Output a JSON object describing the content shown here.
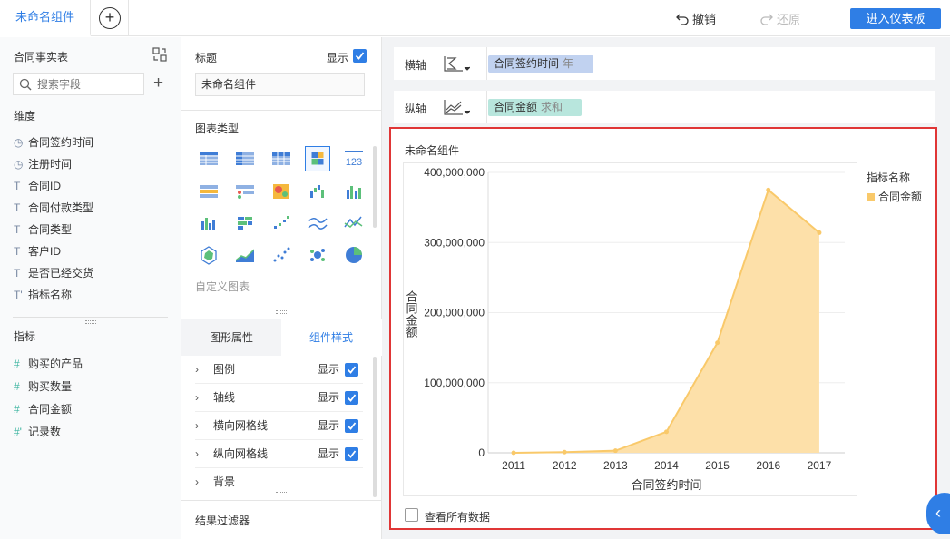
{
  "tabs": {
    "active_label": "未命名组件"
  },
  "toolbar": {
    "undo_label": "撤销",
    "redo_label": "还原",
    "enter_label": "进入仪表板"
  },
  "left_panel": {
    "table_name": "合同事实表",
    "search_placeholder": "搜索字段",
    "dimensions_title": "维度",
    "dimensions": [
      {
        "icon": "clock",
        "label": "合同签约时间"
      },
      {
        "icon": "clock",
        "label": "注册时间"
      },
      {
        "icon": "text",
        "label": "合同ID"
      },
      {
        "icon": "text",
        "label": "合同付款类型"
      },
      {
        "icon": "text",
        "label": "合同类型"
      },
      {
        "icon": "text",
        "label": "客户ID"
      },
      {
        "icon": "text",
        "label": "是否已经交货"
      },
      {
        "icon": "text-star",
        "label": "指标名称"
      }
    ],
    "measures_title": "指标",
    "measures": [
      {
        "icon": "hash",
        "label": "购买的产品"
      },
      {
        "icon": "hash",
        "label": "购买数量"
      },
      {
        "icon": "hash",
        "label": "合同金额"
      },
      {
        "icon": "hash-star",
        "label": "记录数"
      }
    ]
  },
  "mid_panel": {
    "title_label": "标题",
    "show_label": "显示",
    "title_value": "未命名组件",
    "chart_type_label": "图表类型",
    "custom_chart_label": "自定义图表",
    "tab_graphic": "图形属性",
    "tab_style": "组件样式",
    "props": [
      {
        "label": "图例",
        "show": "显示"
      },
      {
        "label": "轴线",
        "show": "显示"
      },
      {
        "label": "横向网格线",
        "show": "显示"
      },
      {
        "label": "纵向网格线",
        "show": "显示"
      },
      {
        "label": "背景",
        "show": ""
      }
    ],
    "filter_label": "结果过滤器"
  },
  "axes": {
    "x_label": "横轴",
    "x_field": "合同签约时间",
    "x_agg": "年",
    "y_label": "纵轴",
    "y_field": "合同金额",
    "y_agg": "求和"
  },
  "widget": {
    "title": "未命名组件",
    "footer_label": "查看所有数据",
    "legend_title": "指标名称"
  },
  "chart_data": {
    "type": "area",
    "title": "",
    "xlabel": "合同签约时间",
    "ylabel": "合同金额",
    "categories": [
      "2011",
      "2012",
      "2013",
      "2014",
      "2015",
      "2016",
      "2017"
    ],
    "series": [
      {
        "name": "合同金额",
        "values": [
          0,
          1000000,
          3000000,
          30000000,
          157000000,
          375000000,
          314000000
        ]
      }
    ],
    "ylim": [
      0,
      400000000
    ],
    "yticks": [
      "0",
      "100,000,000",
      "200,000,000",
      "300,000,000",
      "400,000,000"
    ],
    "legend": "right",
    "grid": "horizontal",
    "color": "#fde0a9",
    "line_color": "#f9c96a"
  },
  "colors": {
    "accent": "#2f7ee5",
    "highlight_border": "#e03636"
  }
}
